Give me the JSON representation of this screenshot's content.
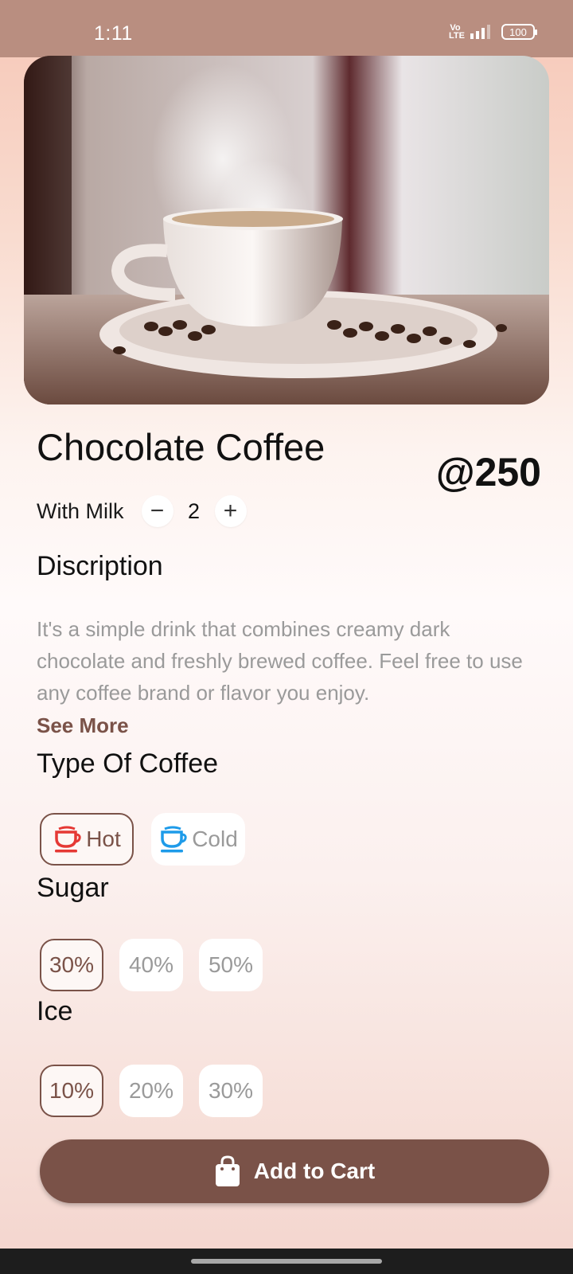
{
  "status_bar": {
    "time": "1:11",
    "battery": "100"
  },
  "product": {
    "name": "Chocolate Coffee",
    "price": "@250",
    "milk_label": "With Milk",
    "quantity": "2",
    "minus_symbol": "−",
    "plus_symbol": "+"
  },
  "description": {
    "heading": "Discription",
    "text": "It's a simple drink that combines creamy dark chocolate and freshly brewed coffee. Feel free to use any coffee brand or flavor you enjoy.",
    "see_more": "See More"
  },
  "coffee_type": {
    "heading": "Type Of Coffee",
    "options": [
      {
        "label": "Hot",
        "selected": true,
        "icon": "cup-icon",
        "icon_color": "#e53935"
      },
      {
        "label": "Cold",
        "selected": false,
        "icon": "cup-icon",
        "icon_color": "#1e9be9"
      }
    ]
  },
  "sugar": {
    "heading": "Sugar",
    "options": [
      {
        "label": "30%",
        "selected": true
      },
      {
        "label": "40%",
        "selected": false
      },
      {
        "label": "50%",
        "selected": false
      }
    ]
  },
  "ice": {
    "heading": "Ice",
    "options": [
      {
        "label": "10%",
        "selected": true
      },
      {
        "label": "20%",
        "selected": false
      },
      {
        "label": "30%",
        "selected": false
      }
    ]
  },
  "cart": {
    "label": "Add to Cart",
    "icon": "shopping-bag-icon"
  },
  "colors": {
    "accent": "#7a5248",
    "status_bar": "#b98e80",
    "hot": "#e53935",
    "cold": "#1e9be9"
  }
}
